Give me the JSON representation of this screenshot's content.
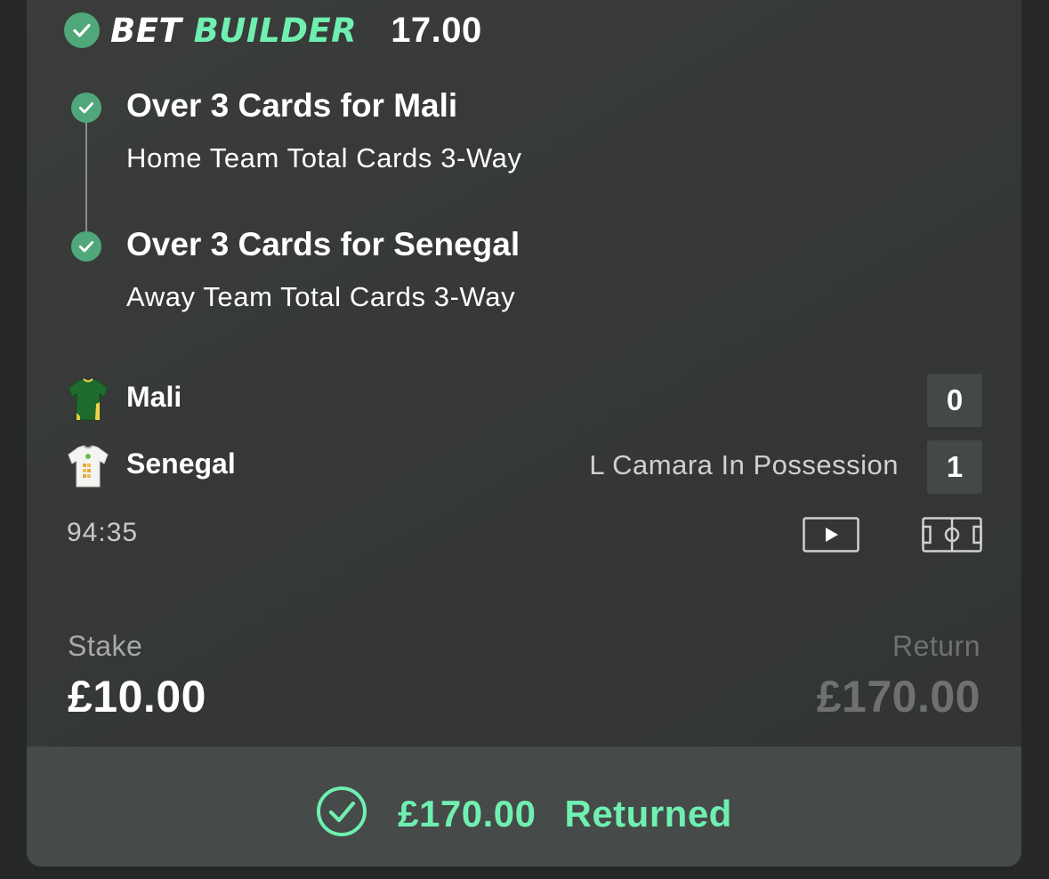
{
  "header": {
    "brand_part1": "BET",
    "brand_part2": "BUILDER",
    "odds": "17.00"
  },
  "selections": [
    {
      "title": "Over 3 Cards for Mali",
      "market": "Home Team Total Cards 3-Way"
    },
    {
      "title": "Over 3 Cards for Senegal",
      "market": "Away Team Total Cards 3-Way"
    }
  ],
  "match": {
    "home": {
      "name": "Mali",
      "score": "0",
      "icon": "green-shirt-icon"
    },
    "away": {
      "name": "Senegal",
      "score": "1",
      "icon": "white-shirt-icon"
    },
    "possession": "L Camara In Possession",
    "clock": "94:35"
  },
  "bet": {
    "stake_label": "Stake",
    "stake_value": "£10.00",
    "return_label": "Return",
    "return_value": "£170.00"
  },
  "footer": {
    "amount": "£170.00",
    "status": "Returned"
  },
  "colors": {
    "accent": "#6ff0b1",
    "check_green": "#4fa77a",
    "card_bg": "#353837",
    "footer_bg": "#464a49"
  }
}
